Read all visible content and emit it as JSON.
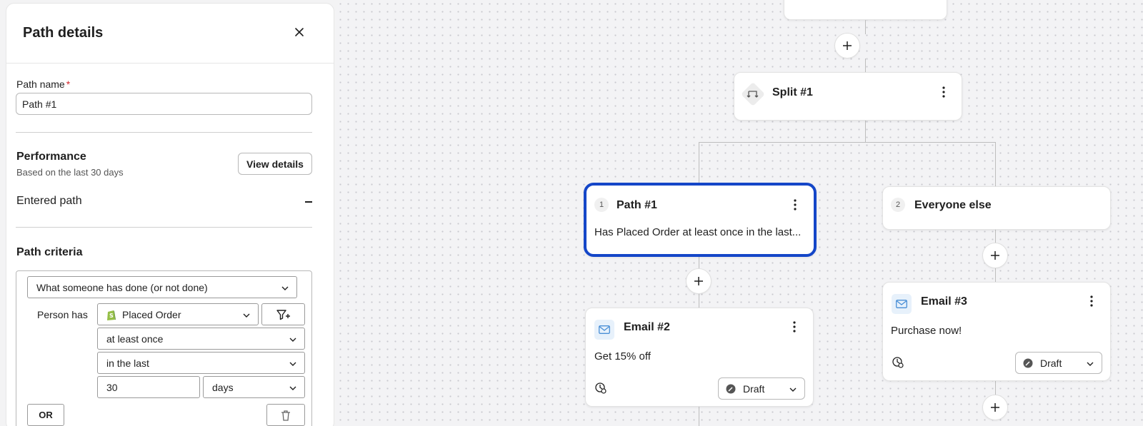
{
  "panel": {
    "title": "Path details",
    "path_name_label": "Path name",
    "required_mark": "*",
    "path_name_value": "Path #1",
    "performance_title": "Performance",
    "performance_subtitle": "Based on the last 30 days",
    "view_details_label": "View details",
    "entered_path_label": "Entered path",
    "criteria_title": "Path criteria",
    "criteria": {
      "condition_type": "What someone has done (or not done)",
      "person_has_label": "Person has",
      "metric": "Placed Order",
      "frequency": "at least once",
      "timeframe": "in the last",
      "amount": "30",
      "unit": "days",
      "or_label": "OR"
    }
  },
  "canvas": {
    "split": {
      "title": "Split #1"
    },
    "path1": {
      "number": "1",
      "title": "Path #1",
      "description": "Has Placed Order at least once in the last..."
    },
    "path2": {
      "number": "2",
      "title": "Everyone else"
    },
    "email2": {
      "title": "Email #2",
      "body": "Get 15% off",
      "status": "Draft"
    },
    "email3": {
      "title": "Email #3",
      "body": "Purchase now!",
      "status": "Draft"
    }
  },
  "colors": {
    "selected_border": "#1446c8",
    "email_icon": "#4a8fd6",
    "shopify_green": "#5e8e3e",
    "required": "#d4282d"
  }
}
